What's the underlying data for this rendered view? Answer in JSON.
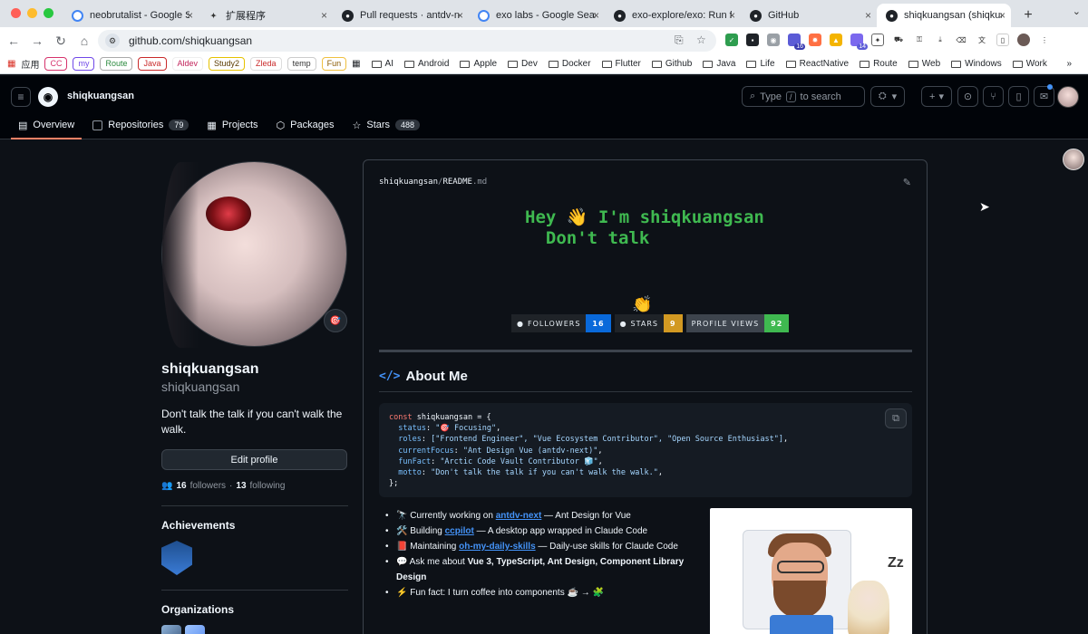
{
  "browser": {
    "tabs": [
      {
        "title": "neobrutalist - Google Sea",
        "favicon": "google-icon"
      },
      {
        "title": "扩展程序",
        "favicon": "puzzle-icon"
      },
      {
        "title": "Pull requests · antdv-nex",
        "favicon": "github-icon"
      },
      {
        "title": "exo labs - Google Search",
        "favicon": "google-icon"
      },
      {
        "title": "exo-explore/exo: Run fron",
        "favicon": "github-icon"
      },
      {
        "title": "GitHub",
        "favicon": "github-icon"
      },
      {
        "title": "shiqkuangsan (shiqkuang",
        "favicon": "github-icon",
        "active": true
      }
    ],
    "url": "github.com/shiqkuangsan",
    "bookmarks": {
      "apps": "应用",
      "chips": [
        "CC",
        "my",
        "Route",
        "Java",
        "Aldev",
        "Study2",
        "Zleda",
        "temp",
        "Fun"
      ],
      "folders": [
        "AI",
        "Android",
        "Apple",
        "Dev",
        "Docker",
        "Flutter",
        "Github",
        "Java",
        "Life",
        "ReactNative",
        "Route",
        "Web",
        "Windows",
        "Work"
      ]
    },
    "ext_badges": [
      "16",
      "14"
    ]
  },
  "header": {
    "username": "shiqkuangsan",
    "search_label": "Type",
    "search_key": "/",
    "search_suffix": "to search",
    "tabs": [
      {
        "label": "Overview"
      },
      {
        "label": "Repositories",
        "count": "79"
      },
      {
        "label": "Projects"
      },
      {
        "label": "Packages"
      },
      {
        "label": "Stars",
        "count": "488"
      }
    ]
  },
  "profile": {
    "name": "shiqkuangsan",
    "login": "shiqkuangsan",
    "bio": "Don't talk the talk if you can't walk the walk.",
    "edit_label": "Edit profile",
    "followers_count": "16",
    "followers_label": "followers",
    "following_count": "13",
    "following_label": "following",
    "achievements_title": "Achievements",
    "organizations_title": "Organizations"
  },
  "readme": {
    "owner": "shiqkuangsan",
    "slash": "/",
    "file": "README",
    "file_ext": ".md",
    "hey_line1": "Hey 👋 I'm shiqkuangsan",
    "hey_line2": "  Don't talk",
    "wave": "👏",
    "shields": [
      {
        "label": "FOLLOWERS",
        "value": "16",
        "color": "#0969da"
      },
      {
        "label": "STARS",
        "value": "9",
        "color": "#d29922"
      },
      {
        "label": "PROFILE VIEWS",
        "value": "92",
        "color": "#3fb950"
      }
    ],
    "about_title": "About Me",
    "code": {
      "line1_kw": "const",
      "line1_name": " shiqkuangsan = {",
      "status_key": "  status",
      "status_val": "\"🎯 Focusing\"",
      "roles_key": "  roles",
      "roles_val": "[\"Frontend Engineer\", \"Vue Ecosystem Contributor\", \"Open Source Enthusiast\"]",
      "focus_key": "  currentFocus",
      "focus_val": "\"Ant Design Vue (antdv-next)\"",
      "fun_key": "  funFact",
      "fun_val": "\"Arctic Code Vault Contributor 🧊\"",
      "motto_key": "  motto",
      "motto_val": "\"Don't talk the talk if you can't walk the walk.\"",
      "close": "};"
    },
    "bullets": {
      "b1_pre": "🔭 Currently working on ",
      "b1_link": "antdv-next",
      "b1_post": " — Ant Design for Vue",
      "b2_pre": "🛠️ Building ",
      "b2_link": "ccpilot",
      "b2_post": " — A desktop app wrapped in Claude Code",
      "b3_pre": "📕 Maintaining ",
      "b3_link": "oh-my-daily-skills",
      "b3_post": " — Daily-use skills for Claude Code",
      "b4_pre": "💬 Ask me about ",
      "b4_bold": "Vue 3, TypeScript, Ant Design, Component Library Design",
      "b5": "⚡ Fun fact: I turn coffee into components ☕ → 🧩"
    },
    "illustration_text": "Zz"
  }
}
